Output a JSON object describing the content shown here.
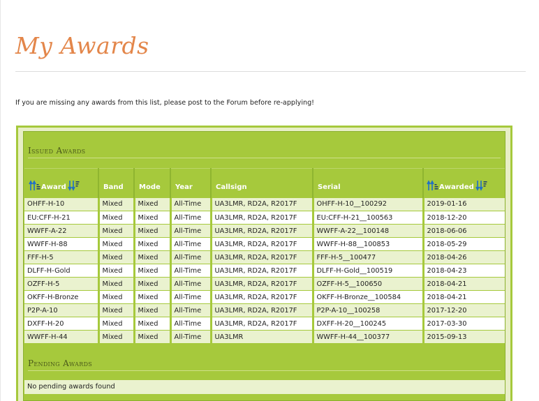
{
  "page": {
    "title": "My Awards",
    "intro": "If you are missing any awards from this list, please post to the Forum before re-applying!"
  },
  "issued": {
    "title": "Issued Awards",
    "columns": {
      "award": "Award",
      "band": "Band",
      "mode": "Mode",
      "year": "Year",
      "callsign": "Callsign",
      "serial": "Serial",
      "awarded": "Awarded"
    },
    "rows": [
      {
        "award": "OHFF-H-10",
        "band": "Mixed",
        "mode": "Mixed",
        "year": "All-Time",
        "callsign": "UA3LMR, RD2A, R2017F",
        "serial": "OHFF-H-10__100292",
        "awarded": "2019-01-16"
      },
      {
        "award": "EU:CFF-H-21",
        "band": "Mixed",
        "mode": "Mixed",
        "year": "All-Time",
        "callsign": "UA3LMR, RD2A, R2017F",
        "serial": "EU:CFF-H-21__100563",
        "awarded": "2018-12-20"
      },
      {
        "award": "WWFF-A-22",
        "band": "Mixed",
        "mode": "Mixed",
        "year": "All-Time",
        "callsign": "UA3LMR, RD2A, R2017F",
        "serial": "WWFF-A-22__100148",
        "awarded": "2018-06-06"
      },
      {
        "award": "WWFF-H-88",
        "band": "Mixed",
        "mode": "Mixed",
        "year": "All-Time",
        "callsign": "UA3LMR, RD2A, R2017F",
        "serial": "WWFF-H-88__100853",
        "awarded": "2018-05-29"
      },
      {
        "award": "FFF-H-5",
        "band": "Mixed",
        "mode": "Mixed",
        "year": "All-Time",
        "callsign": "UA3LMR, RD2A, R2017F",
        "serial": "FFF-H-5__100477",
        "awarded": "2018-04-26"
      },
      {
        "award": "DLFF-H-Gold",
        "band": "Mixed",
        "mode": "Mixed",
        "year": "All-Time",
        "callsign": "UA3LMR, RD2A, R2017F",
        "serial": "DLFF-H-Gold__100519",
        "awarded": "2018-04-23"
      },
      {
        "award": "OZFF-H-5",
        "band": "Mixed",
        "mode": "Mixed",
        "year": "All-Time",
        "callsign": "UA3LMR, RD2A, R2017F",
        "serial": "OZFF-H-5__100650",
        "awarded": "2018-04-21"
      },
      {
        "award": "OKFF-H-Bronze",
        "band": "Mixed",
        "mode": "Mixed",
        "year": "All-Time",
        "callsign": "UA3LMR, RD2A, R2017F",
        "serial": "OKFF-H-Bronze__100584",
        "awarded": "2018-04-21"
      },
      {
        "award": "P2P-A-10",
        "band": "Mixed",
        "mode": "Mixed",
        "year": "All-Time",
        "callsign": "UA3LMR, RD2A, R2017F",
        "serial": "P2P-A-10__100258",
        "awarded": "2017-12-20"
      },
      {
        "award": "DXFF-H-20",
        "band": "Mixed",
        "mode": "Mixed",
        "year": "All-Time",
        "callsign": "UA3LMR, RD2A, R2017F",
        "serial": "DXFF-H-20__100245",
        "awarded": "2017-03-30"
      },
      {
        "award": "WWFF-H-44",
        "band": "Mixed",
        "mode": "Mixed",
        "year": "All-Time",
        "callsign": "UA3LMR",
        "serial": "WWFF-H-44__100377",
        "awarded": "2015-09-13"
      }
    ]
  },
  "pending": {
    "title": "Pending Awards",
    "empty_message": "No pending awards found"
  },
  "icons": {
    "sort_ascending": "sort-ascending-icon",
    "sort_descending": "sort-descending-icon",
    "arrow_color": "#1e6fc8",
    "text_color": "#1a3a6a"
  },
  "colors": {
    "title": "#e3864a",
    "panel_green": "#a6c93c",
    "row_light": "#eaf2cf",
    "row_white": "#ffffff"
  }
}
